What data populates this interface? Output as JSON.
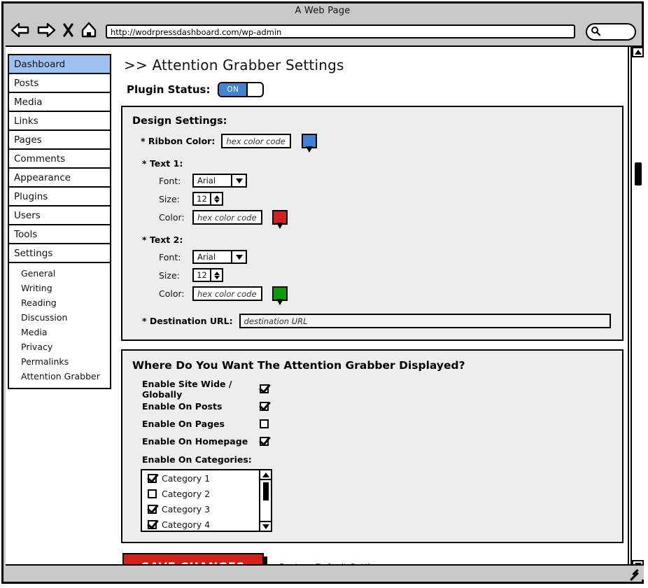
{
  "browser": {
    "title": "A Web Page",
    "url": "http://wodrpressdashboard.com/wp-admin",
    "icons": {
      "back": "back-arrow-icon",
      "forward": "forward-arrow-icon",
      "stop": "close-x-icon",
      "home": "home-icon",
      "search": "search-icon"
    }
  },
  "sidebar": {
    "items": [
      {
        "label": "Dashboard",
        "active": true
      },
      {
        "label": "Posts",
        "active": false
      },
      {
        "label": "Media",
        "active": false
      },
      {
        "label": "Links",
        "active": false
      },
      {
        "label": "Pages",
        "active": false
      },
      {
        "label": "Comments",
        "active": false
      },
      {
        "label": "Appearance",
        "active": false
      },
      {
        "label": "Plugins",
        "active": false
      },
      {
        "label": "Users",
        "active": false
      },
      {
        "label": "Tools",
        "active": false
      },
      {
        "label": "Settings",
        "active": false
      }
    ],
    "sub_items": [
      {
        "label": "General"
      },
      {
        "label": "Writing"
      },
      {
        "label": "Reading"
      },
      {
        "label": "Discussion"
      },
      {
        "label": "Media"
      },
      {
        "label": "Privacy"
      },
      {
        "label": "Permalinks"
      },
      {
        "label": "Attention Grabber"
      }
    ]
  },
  "main": {
    "page_title": ">> Attention Grabber Settings",
    "plugin_status": {
      "label": "Plugin Status:",
      "value": "ON"
    },
    "design": {
      "title": "Design Settings:",
      "ribbon_color": {
        "label": "* Ribbon Color:",
        "placeholder": "hex color code",
        "value": "",
        "swatch": "#3d82d8"
      },
      "text1": {
        "title": "* Text 1:",
        "font_label": "Font:",
        "font_value": "Arial",
        "size_label": "Size:",
        "size_value": "12",
        "color_label": "Color:",
        "color_placeholder": "hex color code",
        "color_value": "",
        "swatch": "#cf2323"
      },
      "text2": {
        "title": "* Text 2:",
        "font_label": "Font:",
        "font_value": "Arial",
        "size_label": "Size:",
        "size_value": "12",
        "color_label": "Color:",
        "color_placeholder": "hex color code",
        "color_value": "",
        "swatch": "#0b9c0b"
      },
      "destination": {
        "label": "* Destination URL:",
        "placeholder": "destination URL",
        "value": ""
      }
    },
    "display": {
      "title": "Where Do You Want The Attention Grabber Displayed?",
      "options": [
        {
          "label": "Enable Site Wide / Globally",
          "checked": true
        },
        {
          "label": "Enable On Posts",
          "checked": true
        },
        {
          "label": "Enable On Pages",
          "checked": false
        },
        {
          "label": "Enable On Homepage",
          "checked": true
        }
      ],
      "categories_label": "Enable On Categories:",
      "categories": [
        {
          "label": "Category 1",
          "checked": true
        },
        {
          "label": "Category 2",
          "checked": false
        },
        {
          "label": "Category 3",
          "checked": true
        },
        {
          "label": "Category 4",
          "checked": true
        }
      ]
    },
    "actions": {
      "save_label": "SAVE CHANGES",
      "restore_label": "Restore Default Settings"
    }
  },
  "colors": {
    "accent_blue": "#4484ce",
    "sidebar_active": "#9dc2ef",
    "save_red": "#d0211c",
    "link_blue": "#1a4fbd",
    "panel_bg": "#ededed",
    "chrome_gray": "#c8c8c8"
  }
}
